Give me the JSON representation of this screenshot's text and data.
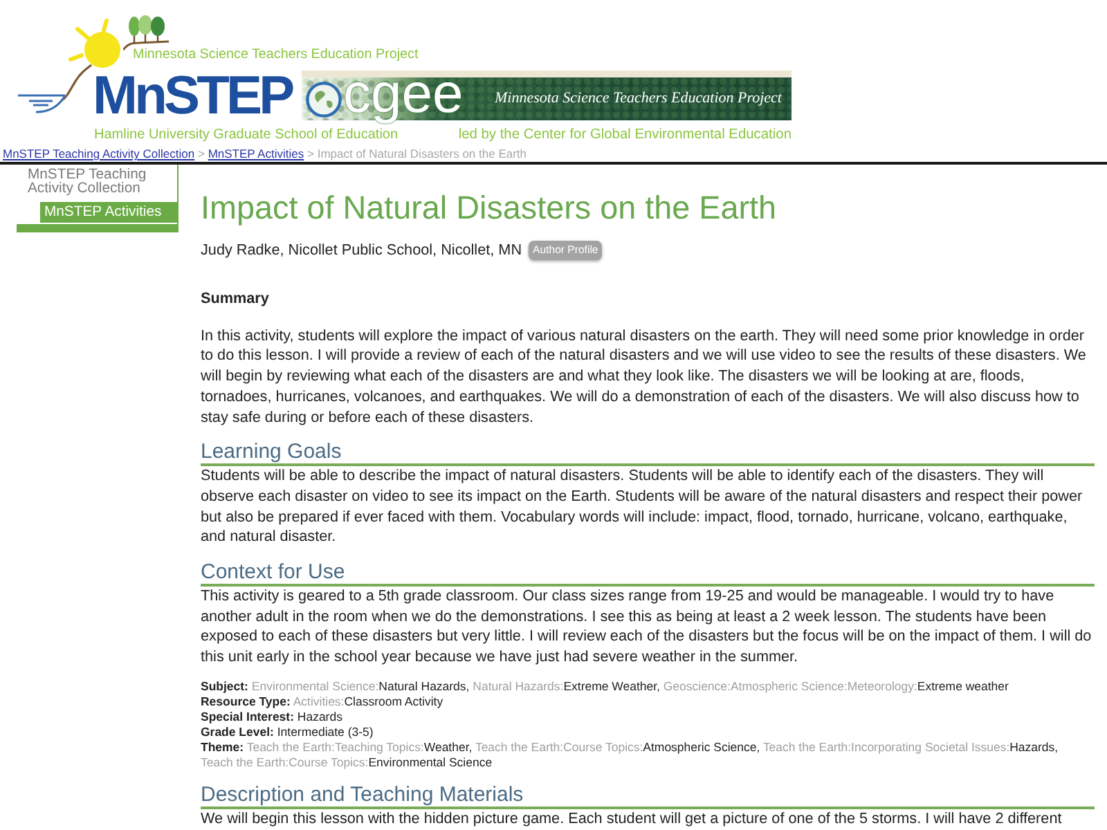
{
  "header": {
    "mnstep_logo": {
      "tagline": "Minnesota Science Teachers Education Project",
      "name": "MnSTEP",
      "subtitle": "Hamline University Graduate School of Education"
    },
    "cgee_banner": {
      "name": "cgee",
      "tagline": "Minnesota Science Teachers Education Project",
      "caption": "led by the Center for Global Environmental Education"
    }
  },
  "breadcrumb": [
    {
      "kind": "link",
      "label": "MnSTEP Teaching Activity Collection"
    },
    {
      "kind": "separator",
      "label": ">"
    },
    {
      "kind": "link",
      "label": "MnSTEP Activities"
    },
    {
      "kind": "separator",
      "label": ">"
    },
    {
      "kind": "current",
      "label": "Impact of Natural Disasters on the Earth"
    }
  ],
  "sidebar": {
    "items": [
      {
        "label": "MnSTEP Teaching Activity Collection",
        "selected": false,
        "children": [
          {
            "label": "MnSTEP Activities",
            "selected": true
          }
        ]
      }
    ]
  },
  "article": {
    "title": "Impact of Natural Disasters on the Earth",
    "author": "Judy Radke, Nicollet Public School, Nicollet, MN",
    "author_profile_button": "Author Profile",
    "sections": [
      {
        "kind": "subheading",
        "heading": "Summary",
        "text": "In this activity, students will explore the impact of various natural disasters on the earth. They will need some prior knowledge in order to do this lesson. I will provide a review of each of the natural disasters and we will use video to see the results of these disasters. We will begin by reviewing what each of the disasters are and what they look like. The disasters we will be looking at are, floods, tornadoes, hurricanes, volcanoes, and earthquakes. We will do a demonstration of each of the disasters. We will also discuss how to stay safe during or before each of these disasters."
      },
      {
        "kind": "section",
        "heading": "Learning Goals",
        "text": "Students will be able to describe the impact of natural disasters. Students will be able to identify each of the disasters. They will observe each disaster on video to see its impact on the Earth. Students will be aware of the natural disasters and respect their power but also be prepared if ever faced with them. Vocabulary words will include: impact, flood, tornado, hurricane, volcano, earthquake, and natural disaster."
      },
      {
        "kind": "section",
        "heading": "Context for Use",
        "text": "This activity is geared to a 5th grade classroom. Our class sizes range from 19-25 and would be manageable. I would try to have another adult in the room when we do the demonstrations. I see this as being at least a 2 week lesson. The students have been exposed to each of these disasters but very little. I will review each of the disasters but the focus will be on the impact of them. I will do this unit early in the school year because we have just had severe weather in the summer."
      },
      {
        "kind": "metadata",
        "rows": [
          {
            "label": "Subject:",
            "terms": [
              {
                "path": "Environmental Science:",
                "term": "Natural Hazards,"
              },
              {
                "path": "Natural Hazards:",
                "term": "Extreme Weather,"
              },
              {
                "path": "Geoscience:Atmospheric Science:Meteorology:",
                "term": "Extreme weather"
              }
            ]
          },
          {
            "label": "Resource Type:",
            "terms": [
              {
                "path": "Activities:",
                "term": "Classroom Activity"
              }
            ]
          },
          {
            "label": "Special Interest:",
            "terms": [
              {
                "term": "Hazards"
              }
            ]
          },
          {
            "label": "Grade Level:",
            "terms": [
              {
                "term": "Intermediate (3-5)"
              }
            ]
          },
          {
            "label": "Theme:",
            "terms": [
              {
                "path": "Teach the Earth:Teaching Topics:",
                "term": "Weather,"
              },
              {
                "path": "Teach the Earth:Course Topics:",
                "term": "Atmospheric Science,"
              },
              {
                "path": "Teach the Earth:Incorporating Societal Issues:",
                "term": "Hazards,"
              },
              {
                "path": "Teach the Earth:Course Topics:",
                "term": "Environmental Science"
              }
            ]
          }
        ]
      },
      {
        "kind": "section",
        "heading": "Description and Teaching Materials",
        "text": "We will begin this lesson with the hidden picture game. Each student will get a picture of one of the 5 storms. I will have 2 different"
      }
    ]
  }
}
